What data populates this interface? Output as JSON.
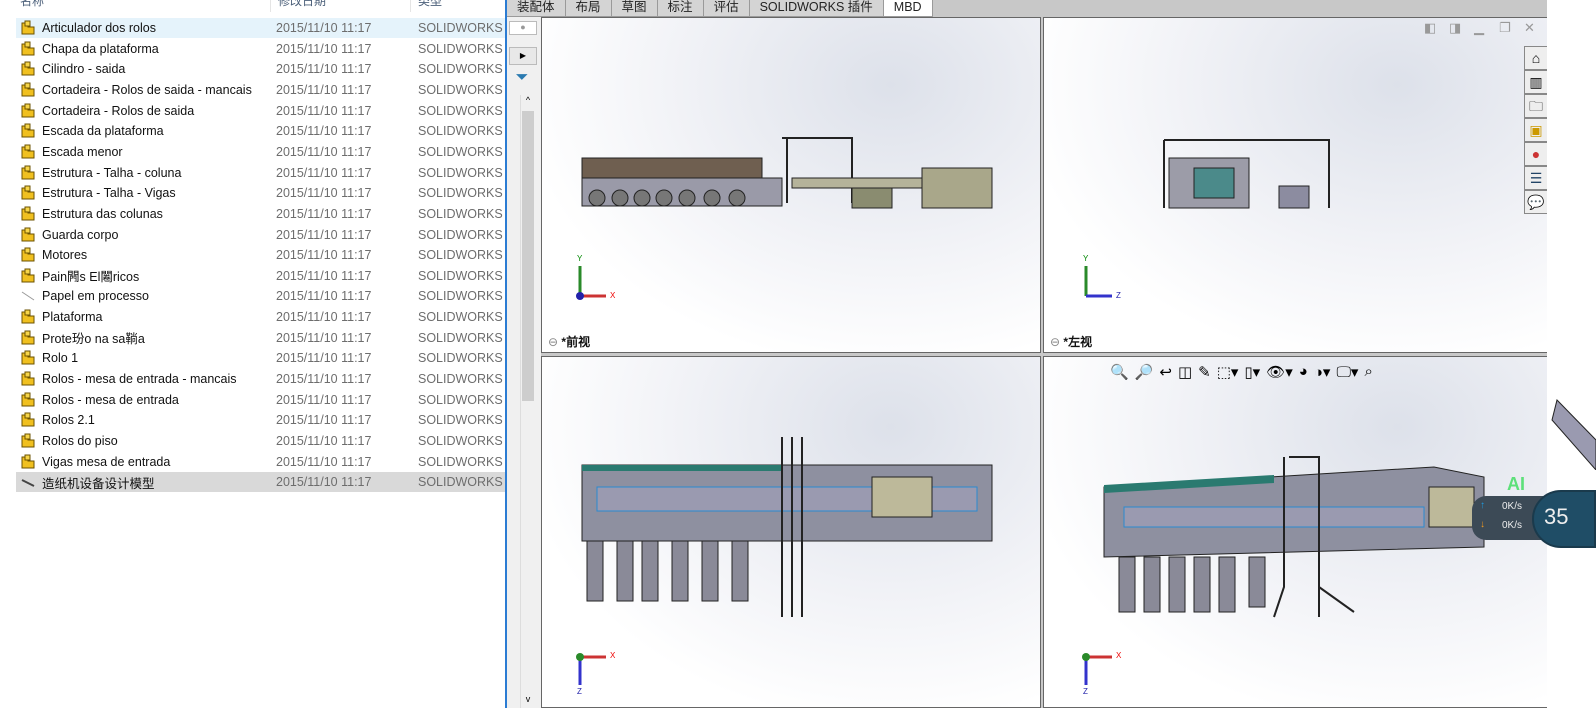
{
  "explorer": {
    "columns": [
      "名称",
      "修改日期",
      "类型"
    ],
    "files": [
      {
        "name": "Articulador dos rolos",
        "date": "2015/11/10 11:17",
        "type": "SOLIDWORKS P",
        "icon": "assembly-icon"
      },
      {
        "name": "Chapa da plataforma",
        "date": "2015/11/10 11:17",
        "type": "SOLIDWORKS P",
        "icon": "assembly-icon"
      },
      {
        "name": "Cilindro - saida",
        "date": "2015/11/10 11:17",
        "type": "SOLIDWORKS P",
        "icon": "assembly-icon"
      },
      {
        "name": "Cortadeira - Rolos de saida - mancais",
        "date": "2015/11/10 11:17",
        "type": "SOLIDWORKS P",
        "icon": "assembly-icon"
      },
      {
        "name": "Cortadeira - Rolos de saida",
        "date": "2015/11/10 11:17",
        "type": "SOLIDWORKS P",
        "icon": "assembly-icon"
      },
      {
        "name": "Escada da plataforma",
        "date": "2015/11/10 11:17",
        "type": "SOLIDWORKS P",
        "icon": "assembly-icon"
      },
      {
        "name": "Escada menor",
        "date": "2015/11/10 11:17",
        "type": "SOLIDWORKS P",
        "icon": "assembly-icon"
      },
      {
        "name": "Estrutura - Talha - coluna",
        "date": "2015/11/10 11:17",
        "type": "SOLIDWORKS P",
        "icon": "assembly-icon"
      },
      {
        "name": "Estrutura - Talha - Vigas",
        "date": "2015/11/10 11:17",
        "type": "SOLIDWORKS P",
        "icon": "assembly-icon"
      },
      {
        "name": "Estrutura das colunas",
        "date": "2015/11/10 11:17",
        "type": "SOLIDWORKS P",
        "icon": "assembly-icon"
      },
      {
        "name": "Guarda corpo",
        "date": "2015/11/10 11:17",
        "type": "SOLIDWORKS P",
        "icon": "assembly-icon"
      },
      {
        "name": "Motores",
        "date": "2015/11/10 11:17",
        "type": "SOLIDWORKS P",
        "icon": "assembly-icon"
      },
      {
        "name": "Pain闁s El闂ricos",
        "date": "2015/11/10 11:17",
        "type": "SOLIDWORKS P",
        "icon": "assembly-icon"
      },
      {
        "name": "Papel em processo",
        "date": "2015/11/10 11:17",
        "type": "SOLIDWORKS P",
        "icon": "part-icon"
      },
      {
        "name": "Plataforma",
        "date": "2015/11/10 11:17",
        "type": "SOLIDWORKS P",
        "icon": "assembly-icon"
      },
      {
        "name": "Prote玢o na sa鞝a",
        "date": "2015/11/10 11:17",
        "type": "SOLIDWORKS P",
        "icon": "assembly-icon"
      },
      {
        "name": "Rolo 1",
        "date": "2015/11/10 11:17",
        "type": "SOLIDWORKS P",
        "icon": "assembly-icon"
      },
      {
        "name": "Rolos - mesa de entrada - mancais",
        "date": "2015/11/10 11:17",
        "type": "SOLIDWORKS P",
        "icon": "assembly-icon"
      },
      {
        "name": "Rolos - mesa de entrada",
        "date": "2015/11/10 11:17",
        "type": "SOLIDWORKS P",
        "icon": "assembly-icon"
      },
      {
        "name": "Rolos 2.1",
        "date": "2015/11/10 11:17",
        "type": "SOLIDWORKS P",
        "icon": "assembly-icon"
      },
      {
        "name": "Rolos do piso",
        "date": "2015/11/10 11:17",
        "type": "SOLIDWORKS P",
        "icon": "assembly-icon"
      },
      {
        "name": "Vigas mesa de entrada",
        "date": "2015/11/10 11:17",
        "type": "SOLIDWORKS P",
        "icon": "assembly-icon"
      },
      {
        "name": "造纸机设备设计模型",
        "date": "2015/11/10 11:17",
        "type": "SOLIDWORKS A",
        "icon": "assembly-doc-icon"
      }
    ]
  },
  "solidworks": {
    "tabs": [
      "装配体",
      "布局",
      "草图",
      "标注",
      "评估",
      "SOLIDWORKS 插件",
      "MBD"
    ],
    "active_tab": "MBD",
    "viewports": {
      "front": "*前视",
      "left": "*左视"
    },
    "axes": {
      "x": "X",
      "y": "Y",
      "z": "Z"
    }
  },
  "netmonitor": {
    "upload": "0K/s",
    "download": "0K/s",
    "badge": "AI",
    "cpu": "35"
  }
}
